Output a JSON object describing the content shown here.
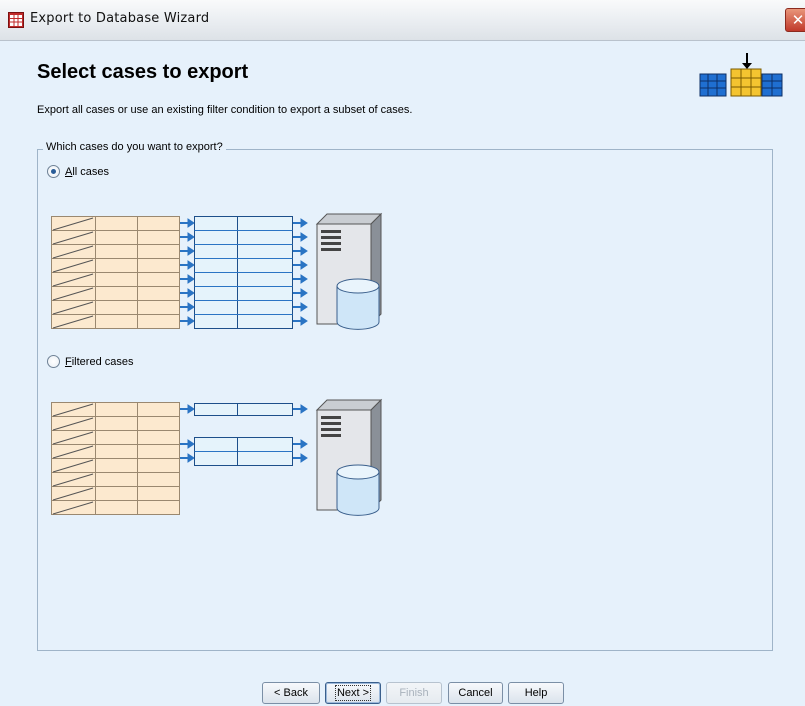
{
  "window": {
    "title": "Export to Database Wizard"
  },
  "page": {
    "heading": "Select cases to export",
    "description": "Export all cases or use an existing filter condition to export a subset of cases."
  },
  "group": {
    "label": "Which cases do you want to export?",
    "options": [
      {
        "label": "All cases",
        "mnemonic": "A",
        "selected": true
      },
      {
        "label": "Filtered cases",
        "mnemonic": "F",
        "selected": false
      }
    ]
  },
  "buttons": {
    "back": "< Back",
    "next": "Next >",
    "finish": "Finish",
    "cancel": "Cancel",
    "help": "Help"
  },
  "colors": {
    "background": "#e6f1fb",
    "source_table": "#fce9cf",
    "target_table": "#e5f3fb",
    "arrow": "#2a74c4",
    "icon_yellow": "#f4c430",
    "icon_blue": "#1f6fd1"
  }
}
